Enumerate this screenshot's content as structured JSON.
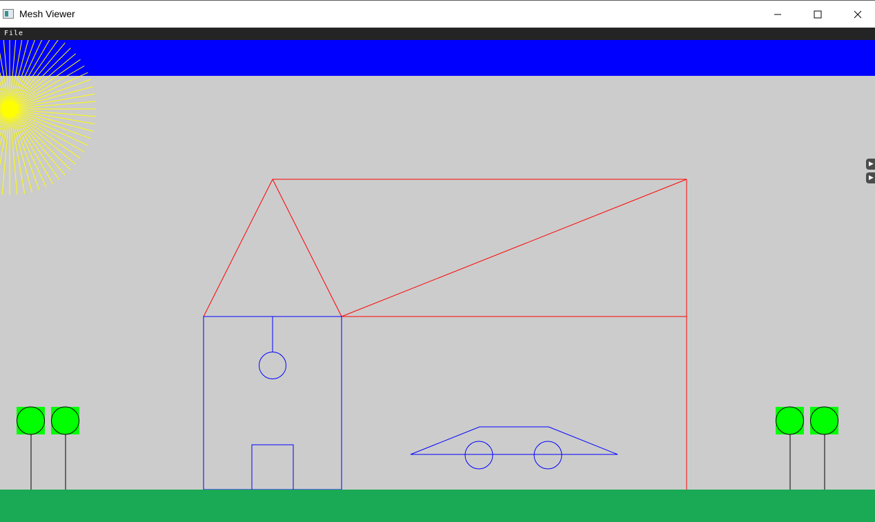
{
  "window": {
    "title": "Mesh Viewer",
    "controls": {
      "minimize": "minimize",
      "maximize": "maximize",
      "close": "close"
    }
  },
  "menubar": {
    "items": [
      {
        "label": "File"
      }
    ]
  },
  "side_controls": [
    {
      "icon": "play-arrow-icon"
    },
    {
      "icon": "play-arrow-icon"
    }
  ],
  "scene": {
    "colors": {
      "sky": "#0000ff",
      "background": "#cccccc",
      "ground": "#1aa954",
      "sun": "#ffff00",
      "roof": "#ff0000",
      "house": "#0000ff",
      "car": "#0000ff",
      "tree_leaf": "#00ff00",
      "tree_trunk": "#000000"
    },
    "objects": [
      "sky",
      "sun",
      "roof",
      "house",
      "window",
      "door",
      "car",
      "trees",
      "ground"
    ]
  }
}
